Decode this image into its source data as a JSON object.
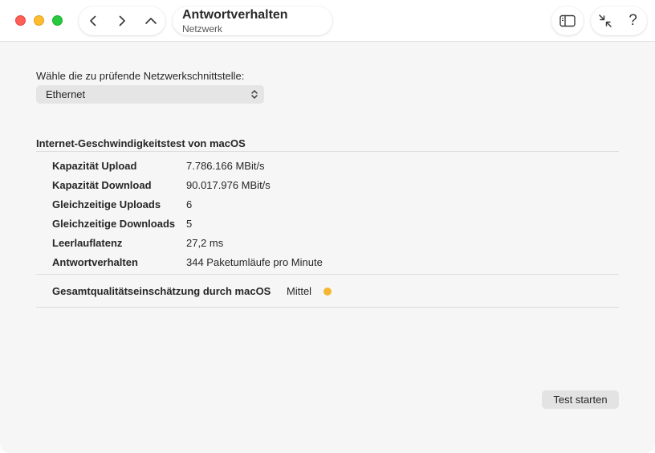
{
  "window": {
    "title": "Antwortverhalten",
    "subtitle": "Netzwerk"
  },
  "toolbar": {
    "back_icon": "chevron-left-icon",
    "forward_icon": "chevron-right-icon",
    "up_icon": "chevron-up-icon",
    "sidebar_icon": "sidebar-icon",
    "collapse_icon": "arrows-collapse-icon",
    "help_label": "?"
  },
  "interface": {
    "label": "Wähle die zu prüfende Netzwerkschnittstelle:",
    "selected": "Ethernet"
  },
  "speedtest": {
    "title": "Internet-Geschwindigkeitstest von macOS",
    "rows": [
      {
        "key": "Kapazität Upload",
        "value": "7.786.166 MBit/s"
      },
      {
        "key": "Kapazität Download",
        "value": "90.017.976 MBit/s"
      },
      {
        "key": "Gleichzeitige Uploads",
        "value": "6"
      },
      {
        "key": "Gleichzeitige Downloads",
        "value": "5"
      },
      {
        "key": "Leerlauflatenz",
        "value": "27,2 ms"
      },
      {
        "key": "Antwortverhalten",
        "value": "344 Paketumläufe pro Minute"
      }
    ],
    "quality": {
      "key": "Gesamtqualitätseinschätzung durch macOS",
      "value": "Mittel",
      "color": "#f5b731"
    }
  },
  "actions": {
    "start_label": "Test starten"
  }
}
